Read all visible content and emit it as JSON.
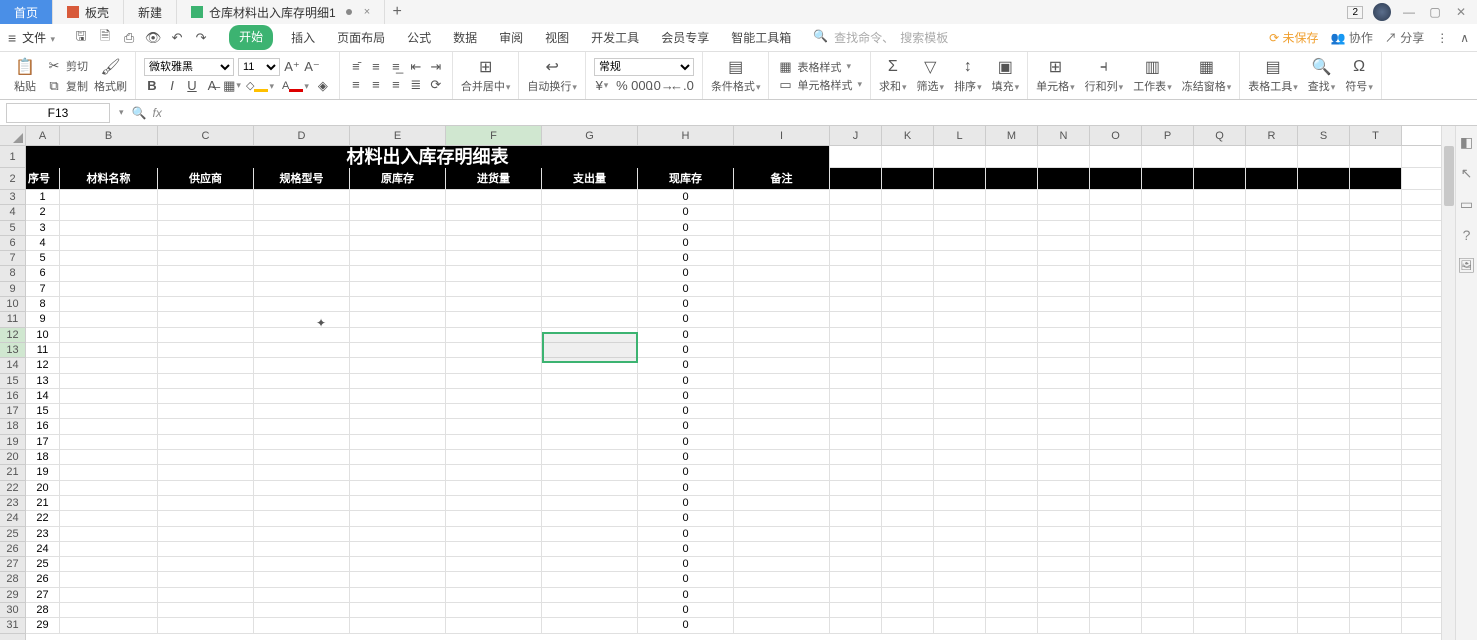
{
  "tabs": {
    "home": "首页",
    "template": "板壳",
    "new": "新建",
    "doc": "仓库材料出入库存明细1"
  },
  "titleRight": {
    "badge": "2"
  },
  "menubar": {
    "file": "文件",
    "tabs": [
      "开始",
      "插入",
      "页面布局",
      "公式",
      "数据",
      "审阅",
      "视图",
      "开发工具",
      "会员专享",
      "智能工具箱"
    ],
    "searchHint1": "查找命令、",
    "searchHint2": "搜索模板",
    "unsaved": "未保存",
    "coop": "协作",
    "share": "分享"
  },
  "ribbon": {
    "paste": "粘贴",
    "cut": "剪切",
    "copy": "复制",
    "fmtBrush": "格式刷",
    "font": "微软雅黑",
    "fontSize": "11",
    "merge": "合并居中",
    "wrap": "自动换行",
    "numFmt": "常规",
    "condFmt": "条件格式",
    "tblStyle": "表格样式",
    "cellStyle": "单元格样式",
    "sum": "求和",
    "filter": "筛选",
    "sort": "排序",
    "fill": "填充",
    "cells": "单元格",
    "rowcol": "行和列",
    "sheet": "工作表",
    "freeze": "冻结窗格",
    "tblTool": "表格工具",
    "find": "查找",
    "symbol": "符号"
  },
  "namebox": "F13",
  "sheet": {
    "title": "材料出入库存明细表",
    "headers": [
      "序号",
      "材料名称",
      "供应商",
      "规格型号",
      "原库存",
      "进货量",
      "支出量",
      "现库存",
      "备注"
    ],
    "cols": [
      "A",
      "B",
      "C",
      "D",
      "E",
      "F",
      "G",
      "H",
      "I",
      "J",
      "K",
      "L",
      "M",
      "N",
      "O",
      "P",
      "Q",
      "R",
      "S",
      "T"
    ],
    "rows": 31,
    "seq": [
      1,
      2,
      3,
      4,
      5,
      6,
      7,
      8,
      9,
      10,
      11,
      12,
      13,
      14,
      15,
      16,
      17,
      18,
      19,
      20,
      21,
      22,
      23,
      24,
      25,
      26,
      27,
      28,
      29
    ],
    "stockVal": "0"
  }
}
